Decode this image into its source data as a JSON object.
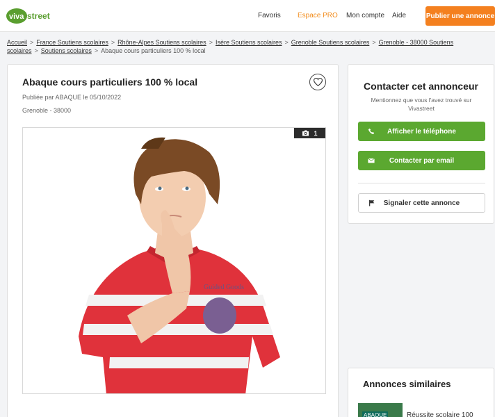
{
  "header": {
    "logo_text": "Vivastreet",
    "nav": {
      "favoris": "Favoris",
      "espace_pro": "Espace PRO",
      "mon_compte": "Mon compte",
      "aide": "Aide"
    },
    "publish_label": "Publier une annonce"
  },
  "breadcrumb": {
    "links": [
      "Accueil",
      "France Soutiens scolaires",
      "Rhône-Alpes Soutiens scolaires",
      "Isère Soutiens scolaires",
      "Grenoble Soutiens scolaires",
      "Grenoble - 38000 Soutiens scolaires",
      "Soutiens scolaires"
    ],
    "current": "Abaque cours particuliers 100 % local",
    "separator": ">"
  },
  "ad": {
    "title": "Abaque cours particuliers 100 % local",
    "published": "Publiée par ABAQUE le 05/10/2022",
    "location": "Grenoble - 38000",
    "photo_count": "1"
  },
  "contact": {
    "title": "Contacter cet annonceur",
    "subtitle": "Mentionnez que vous l'avez trouvé sur Vivastreet",
    "phone_label": "Afficher le téléphone",
    "email_label": "Contacter par email",
    "report_label": "Signaler cette annonce"
  },
  "similar": {
    "title": "Annonces similaires",
    "items": [
      {
        "thumb_text": "ABAQUE",
        "title": "Réussite scolaire 100"
      }
    ]
  },
  "colors": {
    "orange": "#f4801f",
    "green": "#5ba830",
    "logo_green": "#5a9e2f"
  }
}
